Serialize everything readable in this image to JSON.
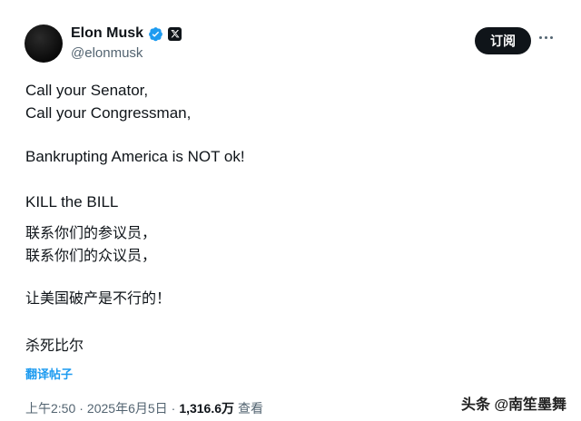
{
  "author": {
    "display_name": "Elon Musk",
    "handle": "@elonmusk"
  },
  "actions": {
    "subscribe_label": "订阅"
  },
  "post": {
    "lines": [
      "Call your Senator,",
      "Call your Congressman,",
      "Bankrupting America is NOT ok!",
      "KILL the BILL",
      "联系你们的参议员，",
      "联系你们的众议员，",
      "让美国破产是不行的！",
      "杀死比尔"
    ]
  },
  "translate_label": "翻译帖子",
  "meta": {
    "time": "上午2:50",
    "date": "2025年6月5日",
    "views_count": "1,316.6万",
    "views_label": "查看"
  },
  "watermark": "头条 @南笙墨舞",
  "colors": {
    "accent": "#1d9bf0",
    "text": "#0f1419",
    "muted": "#536471"
  }
}
